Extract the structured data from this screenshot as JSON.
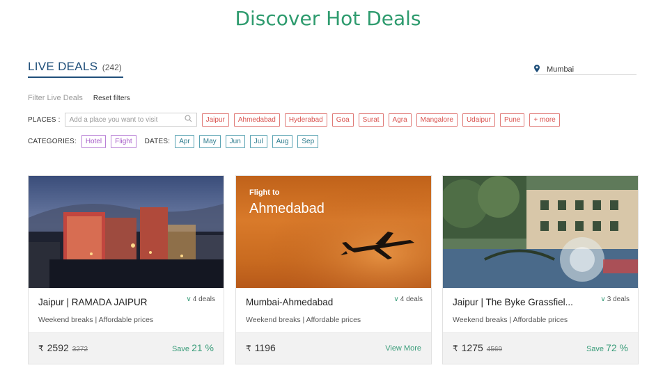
{
  "header": {
    "title": "Discover Hot Deals"
  },
  "live_deals": {
    "title": "LIVE DEALS",
    "count": "(242)"
  },
  "location": {
    "icon": "map-pin-icon",
    "value": "Mumbai"
  },
  "filters": {
    "label": "Filter Live Deals",
    "reset": "Reset filters"
  },
  "places": {
    "label": "PLACES :",
    "search_placeholder": "Add a place you want to visit",
    "tags": [
      "Jaipur",
      "Ahmedabad",
      "Hyderabad",
      "Goa",
      "Surat",
      "Agra",
      "Mangalore",
      "Udaipur",
      "Pune",
      "+ more"
    ]
  },
  "categories": {
    "label": "CATEGORIES:",
    "items": [
      "Hotel",
      "Flight"
    ]
  },
  "dates": {
    "label": "DATES:",
    "items": [
      "Apr",
      "May",
      "Jun",
      "Jul",
      "Aug",
      "Sep"
    ]
  },
  "colors": {
    "accent_green": "#2e9b6e",
    "navy": "#1f4f7a",
    "place_red": "#d9534f",
    "category_purple": "#a65cc7",
    "date_teal": "#2b7a8c"
  },
  "cards": [
    {
      "name": "Jaipur | RAMADA JAIPUR",
      "deals": "4 deals",
      "tagline": "Weekend breaks | Affordable prices",
      "currency": "₹",
      "price": "2592",
      "old_price": "3272",
      "save_label": "Save",
      "save_pct": "21 %"
    },
    {
      "flight_to": "Flight to",
      "flight_city": "Ahmedabad",
      "name": "Mumbai-Ahmedabad",
      "deals": "4 deals",
      "tagline": "Weekend breaks | Affordable prices",
      "currency": "₹",
      "price": "1196",
      "view_more": "View More"
    },
    {
      "name": "Jaipur | The Byke Grassfiel...",
      "deals": "3 deals",
      "tagline": "Weekend breaks | Affordable prices",
      "currency": "₹",
      "price": "1275",
      "old_price": "4569",
      "save_label": "Save",
      "save_pct": "72 %"
    }
  ]
}
